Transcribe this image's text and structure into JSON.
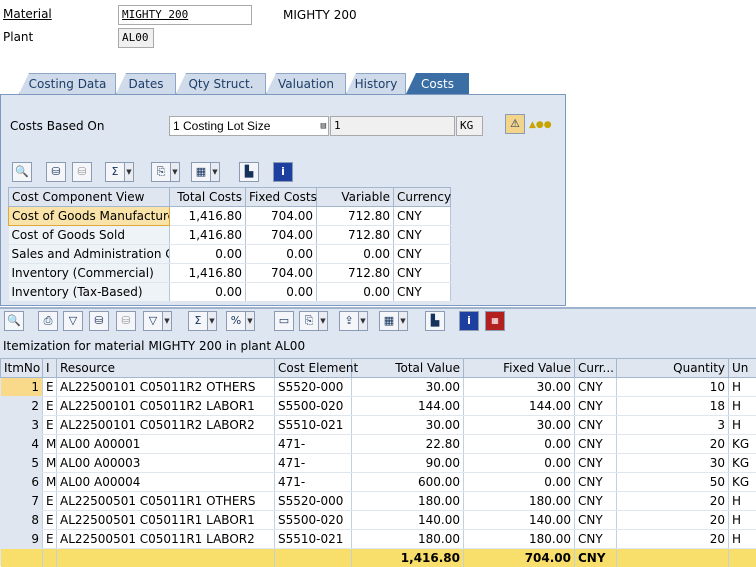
{
  "header": {
    "material_label": "Material",
    "material_value": "MIGHTY 200",
    "material_desc": "MIGHTY 200",
    "plant_label": "Plant",
    "plant_value": "AL00"
  },
  "tabs": [
    {
      "label": "Costing Data"
    },
    {
      "label": "Dates"
    },
    {
      "label": "Qty Struct."
    },
    {
      "label": "Valuation"
    },
    {
      "label": "History"
    },
    {
      "label": "Costs",
      "active": true
    }
  ],
  "costs_panel": {
    "costs_based_on_label": "Costs Based On",
    "costs_based_on_value": "1 Costing Lot Size",
    "lot_size": "1",
    "unit": "KG"
  },
  "cost_view_table": {
    "columns": [
      "Cost Component View",
      "Total Costs",
      "Fixed Costs",
      "Variable",
      "Currency"
    ],
    "rows": [
      {
        "view": "Cost of Goods Manufactured",
        "total": "1,416.80",
        "fixed": "704.00",
        "variable": "712.80",
        "currency": "CNY",
        "selected": true
      },
      {
        "view": "Cost of Goods Sold",
        "total": "1,416.80",
        "fixed": "704.00",
        "variable": "712.80",
        "currency": "CNY"
      },
      {
        "view": "Sales and Administration Cos",
        "total": "0.00",
        "fixed": "0.00",
        "variable": "0.00",
        "currency": "CNY"
      },
      {
        "view": "Inventory (Commercial)",
        "total": "1,416.80",
        "fixed": "704.00",
        "variable": "712.80",
        "currency": "CNY"
      },
      {
        "view": "Inventory (Tax-Based)",
        "total": "0.00",
        "fixed": "0.00",
        "variable": "0.00",
        "currency": "CNY"
      }
    ]
  },
  "itemization": {
    "title": "Itemization for material MIGHTY 200 in plant AL00",
    "columns": [
      "ItmNo",
      "I",
      "Resource",
      "Cost Element",
      "Total Value",
      "Fixed Value",
      "Curr...",
      "Quantity",
      "Un"
    ],
    "rows": [
      {
        "no": "1",
        "cat": "E",
        "resource": "AL22500101 C05011R2 OTHERS",
        "cost_element": "S5520-000",
        "total": "30.00",
        "fixed": "30.00",
        "curr": "CNY",
        "qty": "10",
        "unit": "H"
      },
      {
        "no": "2",
        "cat": "E",
        "resource": "AL22500101 C05011R2 LABOR1",
        "cost_element": "S5500-020",
        "total": "144.00",
        "fixed": "144.00",
        "curr": "CNY",
        "qty": "18",
        "unit": "H"
      },
      {
        "no": "3",
        "cat": "E",
        "resource": "AL22500101 C05011R2 LABOR2",
        "cost_element": "S5510-021",
        "total": "30.00",
        "fixed": "30.00",
        "curr": "CNY",
        "qty": "3",
        "unit": "H"
      },
      {
        "no": "4",
        "cat": "M",
        "resource": "AL00 A00001",
        "cost_element": "471-",
        "total": "22.80",
        "fixed": "0.00",
        "curr": "CNY",
        "qty": "20",
        "unit": "KG"
      },
      {
        "no": "5",
        "cat": "M",
        "resource": "AL00 A00003",
        "cost_element": "471-",
        "total": "90.00",
        "fixed": "0.00",
        "curr": "CNY",
        "qty": "30",
        "unit": "KG"
      },
      {
        "no": "6",
        "cat": "M",
        "resource": "AL00 A00004",
        "cost_element": "471-",
        "total": "600.00",
        "fixed": "0.00",
        "curr": "CNY",
        "qty": "50",
        "unit": "KG"
      },
      {
        "no": "7",
        "cat": "E",
        "resource": "AL22500501 C05011R1 OTHERS",
        "cost_element": "S5520-000",
        "total": "180.00",
        "fixed": "180.00",
        "curr": "CNY",
        "qty": "20",
        "unit": "H"
      },
      {
        "no": "8",
        "cat": "E",
        "resource": "AL22500501 C05011R1 LABOR1",
        "cost_element": "S5500-020",
        "total": "140.00",
        "fixed": "140.00",
        "curr": "CNY",
        "qty": "20",
        "unit": "H"
      },
      {
        "no": "9",
        "cat": "E",
        "resource": "AL22500501 C05011R1 LABOR2",
        "cost_element": "S5510-021",
        "total": "180.00",
        "fixed": "180.00",
        "curr": "CNY",
        "qty": "20",
        "unit": "H"
      }
    ],
    "totals": {
      "total": "1,416.80",
      "fixed": "704.00",
      "curr": "CNY"
    }
  },
  "colors": {
    "tab_active": "#3a6ea5",
    "panel_bg": "#dde6f1",
    "total_row": "#f8de6a",
    "selected_cell": "#f9e3a8"
  }
}
